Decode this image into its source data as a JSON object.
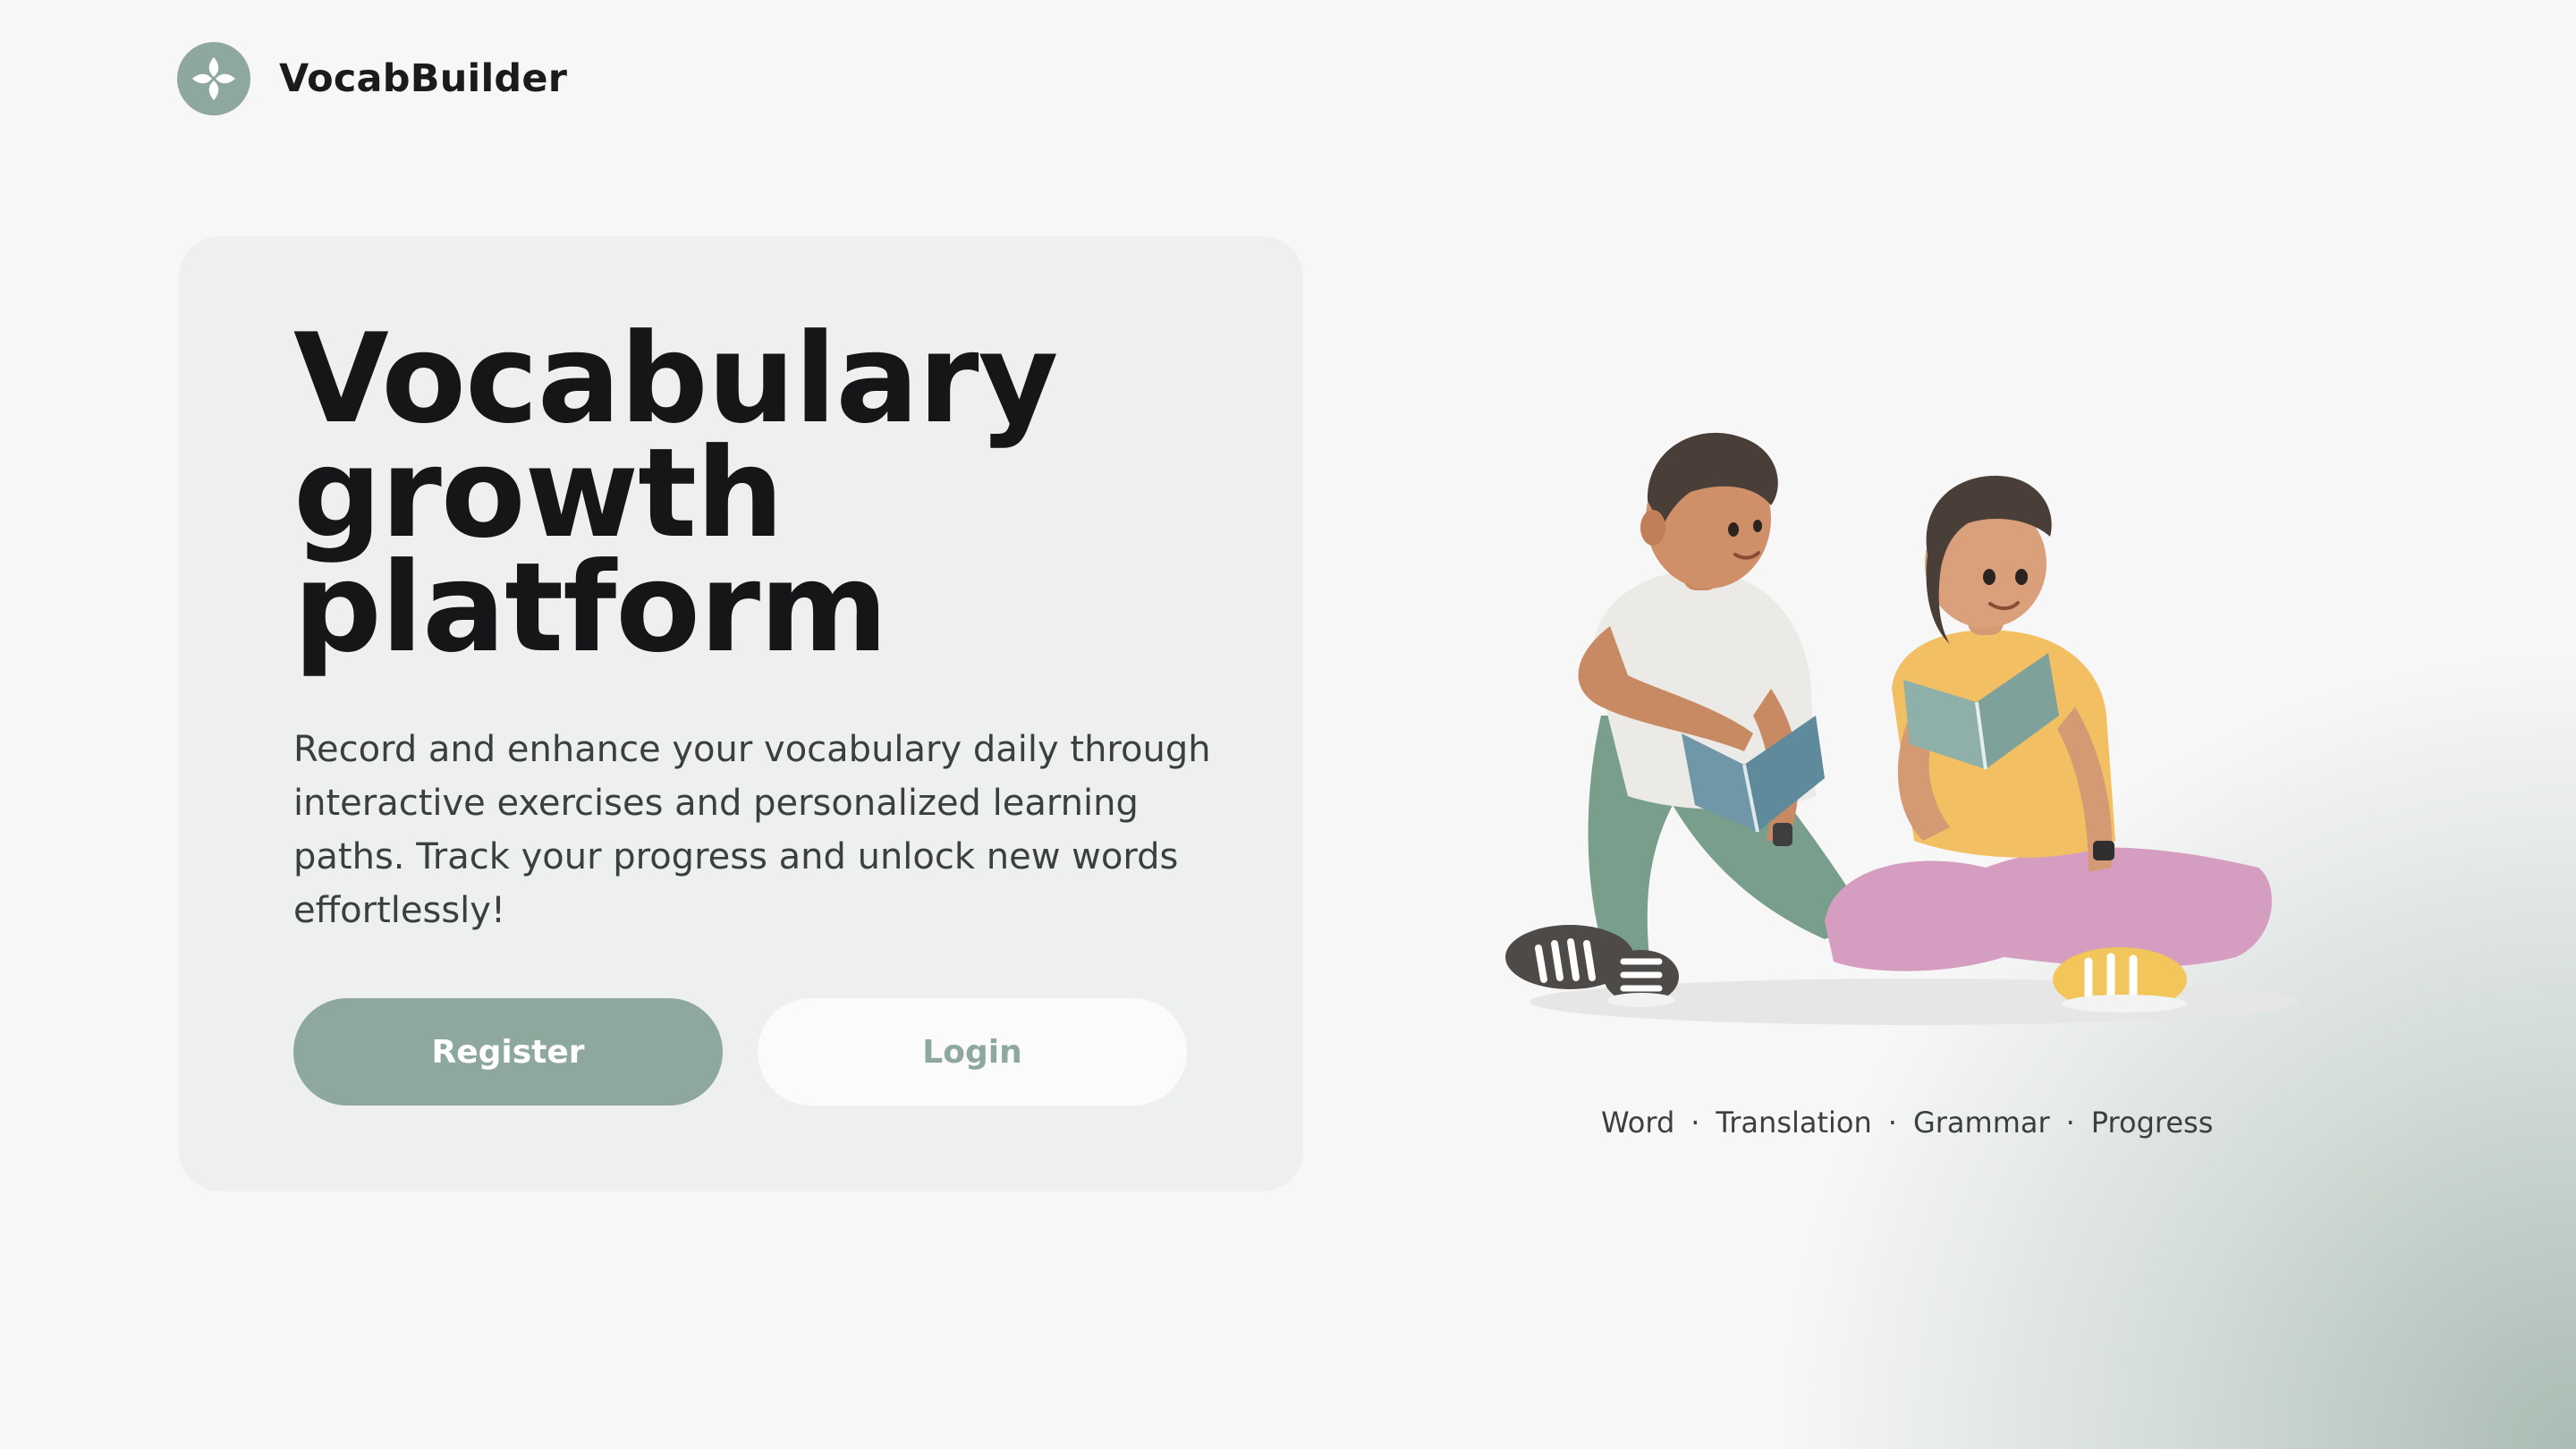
{
  "brand": {
    "name": "VocabBuilder",
    "logo_icon": "four-petal-flower-icon",
    "color": "#8ea89d"
  },
  "hero": {
    "title_lines": [
      "Vocabulary",
      "growth",
      "platform"
    ],
    "description": "Record and enhance your vocabulary daily through interactive exercises and personalized learning paths. Track your progress and unlock new words effortlessly!",
    "register_label": "Register",
    "login_label": "Login"
  },
  "illustration": {
    "icon": "two-students-reading-books-illustration"
  },
  "tags": {
    "items": [
      "Word",
      "Translation",
      "Grammar",
      "Progress"
    ],
    "separator": "·"
  },
  "colors": {
    "accent": "#8ea89d",
    "background": "#f7f7f7",
    "card": "#eef0ef",
    "text": "#141617"
  }
}
